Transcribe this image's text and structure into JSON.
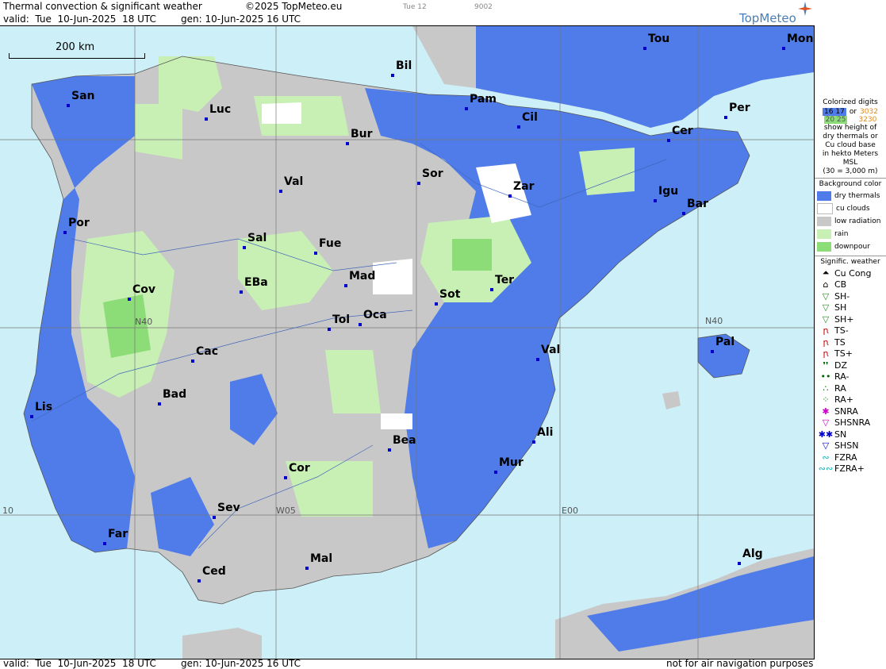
{
  "header": {
    "title": "Thermal convection & significant weather",
    "copyright": "©2025 TopMeteo.eu",
    "day": "Tue 12",
    "code": "9002",
    "valid": "valid:  Tue  10-Jun-2025  18 UTC",
    "gen": "gen: 10-Jun-2025 16 UTC",
    "brand": "TopMeteo"
  },
  "footer": {
    "valid": "valid:  Tue  10-Jun-2025  18 UTC",
    "gen": "gen: 10-Jun-2025 16 UTC",
    "disclaimer": "not for air navigation purposes"
  },
  "scale": {
    "label": "200 km"
  },
  "grid_labels": {
    "n40": "N40",
    "n40_west": "N40",
    "w05": "W05",
    "e00": "E00",
    "w10": "10"
  },
  "cities": [
    {
      "name": "San"
    },
    {
      "name": "Luc"
    },
    {
      "name": "Bil"
    },
    {
      "name": "Pam"
    },
    {
      "name": "Cil"
    },
    {
      "name": "Tou"
    },
    {
      "name": "Mon"
    },
    {
      "name": "Per"
    },
    {
      "name": "Cer"
    },
    {
      "name": "Bur"
    },
    {
      "name": "Sor"
    },
    {
      "name": "Zar"
    },
    {
      "name": "Igu"
    },
    {
      "name": "Bar"
    },
    {
      "name": "Val"
    },
    {
      "name": "Por"
    },
    {
      "name": "Sal"
    },
    {
      "name": "Fue"
    },
    {
      "name": "Mad"
    },
    {
      "name": "Cov"
    },
    {
      "name": "EBa"
    },
    {
      "name": "Tol"
    },
    {
      "name": "Oca"
    },
    {
      "name": "Sot"
    },
    {
      "name": "Ter"
    },
    {
      "name": "Pal"
    },
    {
      "name": "Val"
    },
    {
      "name": "Cac"
    },
    {
      "name": "Lis"
    },
    {
      "name": "Bad"
    },
    {
      "name": "Bea"
    },
    {
      "name": "Ali"
    },
    {
      "name": "Mur"
    },
    {
      "name": "Cor"
    },
    {
      "name": "Sev"
    },
    {
      "name": "Far"
    },
    {
      "name": "Mal"
    },
    {
      "name": "Ced"
    },
    {
      "name": "Alg"
    }
  ],
  "legend": {
    "colorized_title": "Colorized digits",
    "sample1": "16 17",
    "or": "or",
    "sample2": "3032",
    "sample3": "20 25",
    "sample4": "3230",
    "desc1": "show height of",
    "desc2": "dry thermals or",
    "desc3": "Cu cloud base",
    "desc4": "in hekto Meters",
    "desc5": "MSL",
    "desc6": "(30 = 3,000 m)",
    "bg_title": "Background color",
    "backgrounds": [
      {
        "label": "dry thermals",
        "color": "#4f7ce8"
      },
      {
        "label": "cu clouds",
        "color": "#ffffff"
      },
      {
        "label": "low radiation",
        "color": "#c8c8c8"
      },
      {
        "label": "rain",
        "color": "#c8f0b4"
      },
      {
        "label": "downpour",
        "color": "#8cdc78"
      }
    ],
    "wx_title": "Signific. weather",
    "weather": [
      {
        "label": "Cu Cong",
        "icon": "cu-cong-icon",
        "symbol": "⏶",
        "color": "#000"
      },
      {
        "label": "CB",
        "icon": "cb-icon",
        "symbol": "⌂",
        "color": "#000"
      },
      {
        "label": "SH-",
        "icon": "shower-light-icon",
        "symbol": "▽",
        "color": "#2a8a2a"
      },
      {
        "label": "SH",
        "icon": "shower-icon",
        "symbol": "▽",
        "color": "#2a8a2a"
      },
      {
        "label": "SH+",
        "icon": "shower-heavy-icon",
        "symbol": "▽",
        "color": "#2a8a2a"
      },
      {
        "label": "TS-",
        "icon": "thunderstorm-light-icon",
        "symbol": "ꞃ",
        "color": "#c00"
      },
      {
        "label": "TS",
        "icon": "thunderstorm-icon",
        "symbol": "ꞃ",
        "color": "#c00"
      },
      {
        "label": "TS+",
        "icon": "thunderstorm-heavy-icon",
        "symbol": "ꞃ",
        "color": "#c00"
      },
      {
        "label": "DZ",
        "icon": "drizzle-icon",
        "symbol": "❜❜",
        "color": "#060"
      },
      {
        "label": "RA-",
        "icon": "rain-light-icon",
        "symbol": "••",
        "color": "#060"
      },
      {
        "label": "RA",
        "icon": "rain-icon",
        "symbol": "∴",
        "color": "#060"
      },
      {
        "label": "RA+",
        "icon": "rain-heavy-icon",
        "symbol": "⁘",
        "color": "#060"
      },
      {
        "label": "SNRA",
        "icon": "snow-rain-icon",
        "symbol": "✱",
        "color": "#c0c"
      },
      {
        "label": "SHSNRA",
        "icon": "snow-rain-shower-icon",
        "symbol": "▽",
        "color": "#c0c"
      },
      {
        "label": "SN",
        "icon": "snow-icon",
        "symbol": "✱✱",
        "color": "#00c"
      },
      {
        "label": "SHSN",
        "icon": "snow-shower-icon",
        "symbol": "▽",
        "color": "#00c"
      },
      {
        "label": "FZRA",
        "icon": "freezing-rain-icon",
        "symbol": "∾",
        "color": "#0bb"
      },
      {
        "label": "FZRA+",
        "icon": "freezing-rain-heavy-icon",
        "symbol": "∾∾",
        "color": "#0bb"
      }
    ]
  },
  "colors": {
    "sea": "#cdeff7",
    "land_grey": "#c8c8c8",
    "dry": "#4f7ce8",
    "rain": "#c8f0b4",
    "downpour": "#8cdc78",
    "cu": "#ffffff"
  }
}
